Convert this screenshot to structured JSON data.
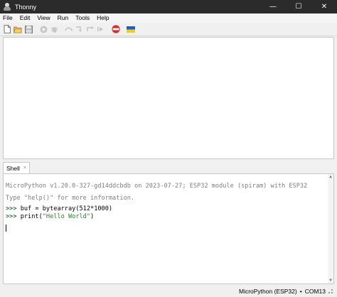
{
  "window": {
    "title": "Thonny",
    "minimize": "—",
    "maximize": "☐",
    "close": "✕"
  },
  "menu": [
    "File",
    "Edit",
    "View",
    "Run",
    "Tools",
    "Help"
  ],
  "toolbar": {
    "icons": [
      "new-file-icon",
      "open-file-icon",
      "save-file-icon",
      "run-icon",
      "debug-icon",
      "step-over-icon",
      "step-into-icon",
      "step-out-icon",
      "resume-icon",
      "stop-icon",
      "support-ukraine-flag-icon"
    ],
    "stop_label": "STOP"
  },
  "shell": {
    "tab_label": "Shell",
    "tab_close": "×",
    "banner_line1": "MicroPython v1.20.0-327-gd14ddcbdb on 2023-07-27; ESP32 module (spiram) with ESP32",
    "banner_line2": "Type \"help()\" for more information.",
    "prompt": ">>>",
    "cmd1_prefix": " buf = bytearray(",
    "cmd1_args": "512*1000",
    "cmd1_suffix": ")",
    "cmd2_prefix": " print(",
    "cmd2_string": "\"Hello World\"",
    "cmd2_suffix": ")"
  },
  "status": {
    "interpreter": "MicroPython (ESP32)",
    "separator": "•",
    "port": "COM13"
  },
  "colors": {
    "titlebar": "#2b2b2b",
    "prompt": "#2e6b3a",
    "string": "#2e7d32",
    "banner": "#7f7f7f",
    "stop": "#d32f2f"
  }
}
